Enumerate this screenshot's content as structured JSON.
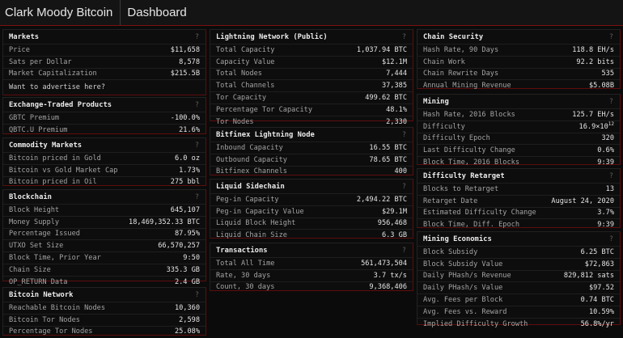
{
  "header": {
    "brand": "Clark Moody Bitcoin",
    "tab": "Dashboard"
  },
  "help": "?",
  "markets": {
    "title": "Markets",
    "rows": [
      {
        "label": "Price",
        "value": "$11,658"
      },
      {
        "label": "Sats per Dollar",
        "value": "8,578"
      },
      {
        "label": "Market Capitalization",
        "value": "$215.5B"
      }
    ],
    "ad": "Want to advertise here?"
  },
  "etp": {
    "title": "Exchange-Traded Products",
    "rows": [
      {
        "label": "GBTC Premium",
        "value": "-100.0%"
      },
      {
        "label": "QBTC.U Premium",
        "value": "21.6%"
      }
    ]
  },
  "commodity": {
    "title": "Commodity Markets",
    "rows": [
      {
        "label": "Bitcoin priced in Gold",
        "value": "6.0 oz"
      },
      {
        "label": "Bitcoin vs Gold Market Cap",
        "value": "1.73%"
      },
      {
        "label": "Bitcoin priced in Oil",
        "value": "275 bbl"
      }
    ]
  },
  "blockchain": {
    "title": "Blockchain",
    "rows": [
      {
        "label": "Block Height",
        "value": "645,107"
      },
      {
        "label": "Money Supply",
        "value": "18,469,352.33 BTC"
      },
      {
        "label": "Percentage Issued",
        "value": "87.95%"
      },
      {
        "label": "UTXO Set Size",
        "value": "66,570,257"
      },
      {
        "label": "Block Time, Prior Year",
        "value": "9:50"
      },
      {
        "label": "Chain Size",
        "value": "335.3 GB"
      },
      {
        "label": "OP_RETURN Data",
        "value": "2.4 GB"
      }
    ]
  },
  "btc_network": {
    "title": "Bitcoin Network",
    "rows": [
      {
        "label": "Reachable Bitcoin Nodes",
        "value": "10,360"
      },
      {
        "label": "Bitcoin Tor Nodes",
        "value": "2,598"
      },
      {
        "label": "Percentage Tor Nodes",
        "value": "25.08%"
      }
    ]
  },
  "lightning": {
    "title": "Lightning Network (Public)",
    "rows": [
      {
        "label": "Total Capacity",
        "value": "1,037.94 BTC"
      },
      {
        "label": "Capacity Value",
        "value": "$12.1M"
      },
      {
        "label": "Total Nodes",
        "value": "7,444"
      },
      {
        "label": "Total Channels",
        "value": "37,385"
      },
      {
        "label": "Tor Capacity",
        "value": "499.62 BTC"
      },
      {
        "label": "Percentage Tor Capacity",
        "value": "48.1%"
      },
      {
        "label": "Tor Nodes",
        "value": "2,330"
      }
    ]
  },
  "bitfinex": {
    "title": "Bitfinex Lightning Node",
    "rows": [
      {
        "label": "Inbound Capacity",
        "value": "16.55 BTC"
      },
      {
        "label": "Outbound Capacity",
        "value": "78.65 BTC"
      },
      {
        "label": "Bitfinex Channels",
        "value": "400"
      }
    ]
  },
  "liquid": {
    "title": "Liquid Sidechain",
    "rows": [
      {
        "label": "Peg-in Capacity",
        "value": "2,494.22 BTC"
      },
      {
        "label": "Peg-in Capacity Value",
        "value": "$29.1M"
      },
      {
        "label": "Liquid Block Height",
        "value": "956,468"
      },
      {
        "label": "Liquid Chain Size",
        "value": "6.3 GB"
      }
    ]
  },
  "transactions": {
    "title": "Transactions",
    "rows": [
      {
        "label": "Total All Time",
        "value": "561,473,504"
      },
      {
        "label": "Rate, 30 days",
        "value": "3.7 tx/s"
      },
      {
        "label": "Count, 30 days",
        "value": "9,368,406"
      }
    ]
  },
  "chain_security": {
    "title": "Chain Security",
    "rows": [
      {
        "label": "Hash Rate, 90 Days",
        "value": "118.8 EH/s"
      },
      {
        "label": "Chain Work",
        "value": "92.2 bits"
      },
      {
        "label": "Chain Rewrite Days",
        "value": "535"
      },
      {
        "label": "Annual Mining Revenue",
        "value": "$5.08B"
      }
    ]
  },
  "mining": {
    "title": "Mining",
    "rows": [
      {
        "label": "Hash Rate, 2016 Blocks",
        "value": "125.7 EH/s"
      },
      {
        "label": "Difficulty",
        "value": "16.9×10",
        "sup": "12"
      },
      {
        "label": "Difficulty Epoch",
        "value": "320"
      },
      {
        "label": "Last Difficulty Change",
        "value": "0.6%"
      },
      {
        "label": "Block Time, 2016 Blocks",
        "value": "9:39"
      }
    ]
  },
  "retarget": {
    "title": "Difficulty Retarget",
    "rows": [
      {
        "label": "Blocks to Retarget",
        "value": "13"
      },
      {
        "label": "Retarget Date",
        "value": "August 24, 2020"
      },
      {
        "label": "Estimated Difficulty Change",
        "value": "3.7%"
      },
      {
        "label": "Block Time, Diff. Epoch",
        "value": "9:39"
      }
    ]
  },
  "economics": {
    "title": "Mining Economics",
    "rows": [
      {
        "label": "Block Subsidy",
        "value": "6.25 BTC"
      },
      {
        "label": "Block Subsidy Value",
        "value": "$72,863"
      },
      {
        "label": "Daily PHash/s Revenue",
        "value": "829,812 sats"
      },
      {
        "label": "Daily PHash/s Value",
        "value": "$97.52"
      },
      {
        "label": "Avg. Fees per Block",
        "value": "0.74 BTC"
      },
      {
        "label": "Avg. Fees vs. Reward",
        "value": "10.59%"
      },
      {
        "label": "Implied Difficulty Growth",
        "value": "56.8%/yr"
      }
    ]
  }
}
